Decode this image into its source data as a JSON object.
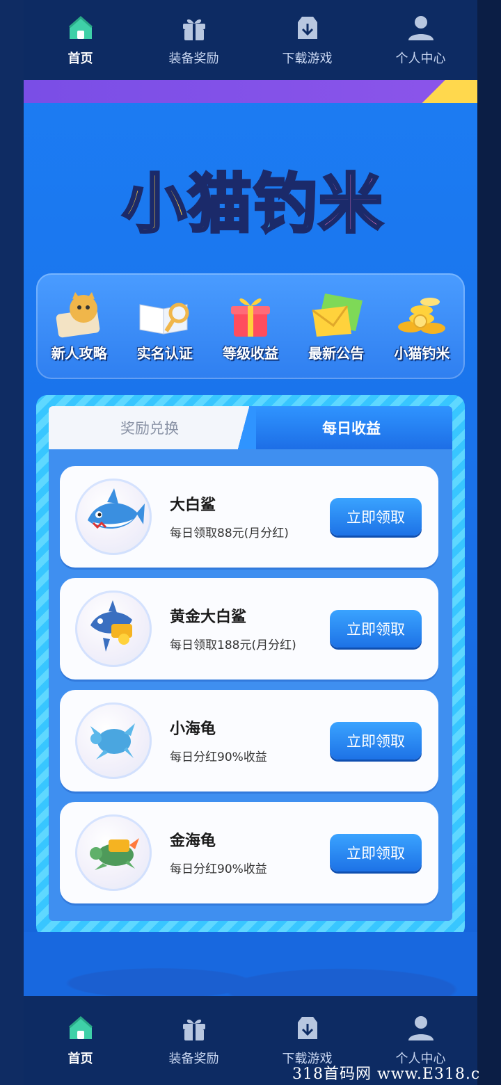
{
  "nav": {
    "items": [
      {
        "label": "首页",
        "icon": "home-icon",
        "active": true
      },
      {
        "label": "装备奖励",
        "icon": "gift-icon",
        "active": false
      },
      {
        "label": "下载游戏",
        "icon": "download-icon",
        "active": false
      },
      {
        "label": "个人中心",
        "icon": "user-icon",
        "active": false
      }
    ]
  },
  "logo": {
    "text": [
      "小",
      "猫",
      "钓",
      "米"
    ]
  },
  "quick": {
    "items": [
      {
        "label": "新人攻略",
        "icon": "cat-guide-icon"
      },
      {
        "label": "实名认证",
        "icon": "book-magnifier-icon"
      },
      {
        "label": "等级收益",
        "icon": "gift-box-icon"
      },
      {
        "label": "最新公告",
        "icon": "envelope-icon"
      },
      {
        "label": "小猫钓米",
        "icon": "coins-icon"
      }
    ]
  },
  "tabs": {
    "exchange": "奖励兑换",
    "daily": "每日收益",
    "active": "daily"
  },
  "cards": [
    {
      "title": "大白鲨",
      "desc": "每日领取88元(月分红)",
      "button": "立即领取",
      "icon": "shark-icon"
    },
    {
      "title": "黄金大白鲨",
      "desc": "每日领取188元(月分红)",
      "button": "立即领取",
      "icon": "golden-shark-icon"
    },
    {
      "title": "小海龟",
      "desc": "每日分红90%收益",
      "button": "立即领取",
      "icon": "turtle-icon"
    },
    {
      "title": "金海龟",
      "desc": "每日分红90%收益",
      "button": "立即领取",
      "icon": "golden-turtle-icon"
    }
  ],
  "watermark": "318首码网 www.E318.c",
  "colors": {
    "nav_bg": "#0d2b63",
    "app_bg": "#1c7ef5",
    "button": "#1d72e6",
    "accent_purple": "#7a4ee6"
  }
}
